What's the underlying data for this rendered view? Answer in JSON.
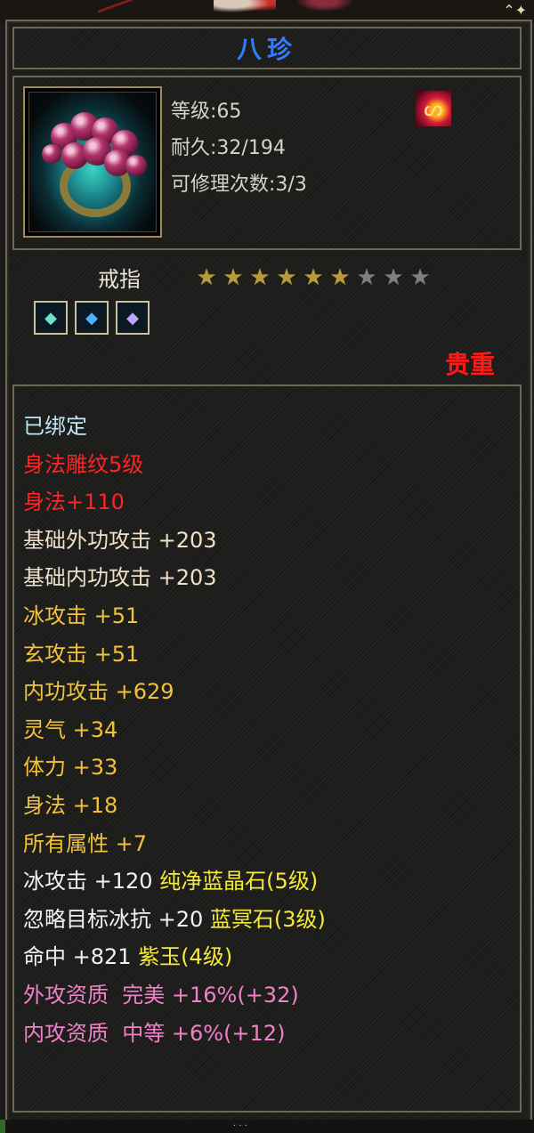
{
  "item": {
    "name": "八珍",
    "level_text": "等级:65",
    "durability_text": "耐久:32/194",
    "repair_text": "可修理次数:3/3",
    "type": "戒指",
    "stars": {
      "filled": 6,
      "total": 9
    },
    "rarity": "贵重",
    "gem_icons": [
      "gem-cyan",
      "gem-blue",
      "gem-purple"
    ]
  },
  "attributes": [
    {
      "text": "已绑定",
      "color": "bound"
    },
    {
      "text": "身法雕纹5级",
      "color": "red"
    },
    {
      "text": "身法+110",
      "color": "red"
    },
    {
      "text": "基础外功攻击 +203",
      "color": "base"
    },
    {
      "text": "基础内功攻击 +203",
      "color": "base"
    },
    {
      "text": "冰攻击 +51",
      "color": "yellow"
    },
    {
      "text": "玄攻击 +51",
      "color": "yellow"
    },
    {
      "text": "内功攻击 +629",
      "color": "yellow"
    },
    {
      "text": "灵气 +34",
      "color": "yellow"
    },
    {
      "text": "体力 +33",
      "color": "yellow"
    },
    {
      "text": "身法 +18",
      "color": "yellow"
    },
    {
      "text": "所有属性 +7",
      "color": "yellow"
    },
    {
      "text": "冰攻击 +120 ",
      "gem": "纯净蓝晶石(5级)",
      "color": "white"
    },
    {
      "text": "忽略目标冰抗 +20 ",
      "gem": "蓝冥石(3级)",
      "color": "white"
    },
    {
      "text": "命中 +821 ",
      "gem": "紫玉(4级)",
      "color": "white"
    },
    {
      "text": "外攻资质  完美 +16%(+32)",
      "color": "pink"
    },
    {
      "text": "内攻资质  中等 +6%(+12)",
      "color": "pink"
    }
  ]
}
